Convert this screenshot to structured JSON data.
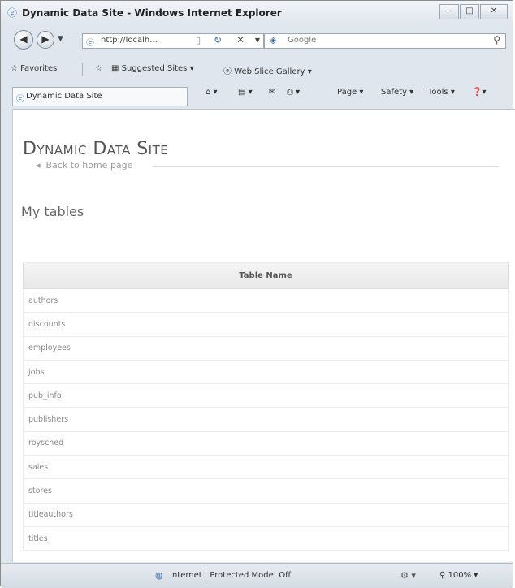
{
  "window": {
    "title": "Dynamic Data Site - Windows Internet Explorer"
  },
  "address": {
    "url": "http://localh..."
  },
  "search": {
    "placeholder": "Google"
  },
  "favorites": {
    "label": "Favorites",
    "suggested": "Suggested Sites ▾",
    "webslice": "Web Slice Gallery ▾"
  },
  "tab": {
    "label": "Dynamic Data Site"
  },
  "commands": {
    "page": "Page ▾",
    "safety": "Safety ▾",
    "tools": "Tools ▾"
  },
  "page": {
    "site_title": "Dynamic Data Site",
    "back_link": "Back to home page",
    "heading": "My tables",
    "table": {
      "header": "Table Name",
      "rows": [
        "authors",
        "discounts",
        "employees",
        "jobs",
        "pub_info",
        "publishers",
        "roysched",
        "sales",
        "stores",
        "titleauthors",
        "titles"
      ]
    }
  },
  "status": {
    "zone": "Internet | Protected Mode: Off",
    "zoom": "100%"
  }
}
